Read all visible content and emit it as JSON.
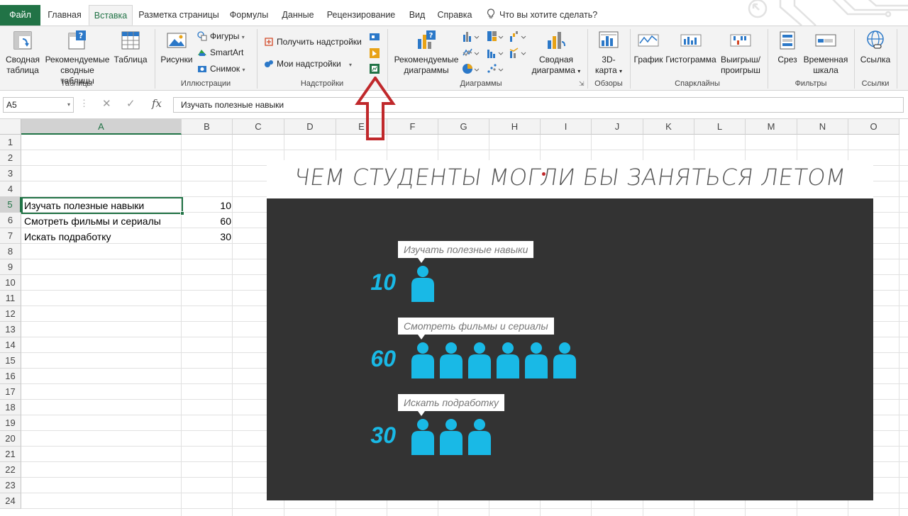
{
  "tabs": [
    "Файл",
    "Главная",
    "Вставка",
    "Разметка страницы",
    "Формулы",
    "Данные",
    "Рецензирование",
    "Вид",
    "Справка"
  ],
  "tell_me": "Что вы хотите сделать?",
  "ribbon": {
    "tables": {
      "label": "Таблицы",
      "pivot_line1": "Сводная",
      "pivot_line2": "таблица",
      "rec_pivot_line1": "Рекомендуемые",
      "rec_pivot_line2": "сводные таблицы",
      "table": "Таблица"
    },
    "illustrations": {
      "label": "Иллюстрации",
      "pictures": "Рисунки",
      "shapes": "Фигуры",
      "smartart": "SmartArt",
      "screenshot": "Снимок"
    },
    "addins": {
      "label": "Надстройки",
      "get": "Получить надстройки",
      "my": "Мои надстройки"
    },
    "charts": {
      "label": "Диаграммы",
      "rec_line1": "Рекомендуемые",
      "rec_line2": "диаграммы",
      "pivot_chart_line1": "Сводная",
      "pivot_chart_line2": "диаграмма"
    },
    "tours": {
      "label": "Обзоры",
      "map3d_line1": "3D-",
      "map3d_line2": "карта"
    },
    "sparklines": {
      "label": "Спарклайны",
      "line": "График",
      "column": "Гистограмма",
      "winloss_line1": "Выигрыш/",
      "winloss_line2": "проигрыш"
    },
    "filters": {
      "label": "Фильтры",
      "slicer": "Срез",
      "timeline_line1": "Временная",
      "timeline_line2": "шкала"
    },
    "links": {
      "label": "Ссылки",
      "link": "Ссылка"
    }
  },
  "formula_bar": {
    "name_box": "A5",
    "content": "Изучать полезные навыки"
  },
  "columns": [
    "A",
    "B",
    "C",
    "D",
    "E",
    "F",
    "G",
    "H",
    "I",
    "J",
    "K",
    "L",
    "M",
    "N",
    "O"
  ],
  "rows": [
    "1",
    "2",
    "3",
    "4",
    "5",
    "6",
    "7",
    "8",
    "9",
    "10",
    "11",
    "12",
    "13",
    "14",
    "15",
    "16",
    "17",
    "18",
    "19",
    "20",
    "21",
    "22",
    "23",
    "24"
  ],
  "cells": [
    {
      "label": "Изучать полезные навыки",
      "value": "10"
    },
    {
      "label": "Смотреть фильмы и сериалы",
      "value": "60"
    },
    {
      "label": "Искать подработку",
      "value": "30"
    }
  ],
  "chart_data": {
    "type": "table",
    "title": "ЧЕМ СТУДЕНТЫ МОГЛИ БЫ ЗАНЯТЬСЯ ЛЕТОМ",
    "categories": [
      "Изучать полезные навыки",
      "Смотреть фильмы и сериалы",
      "Искать подработку"
    ],
    "values": [
      10,
      60,
      30
    ],
    "icons_per_row": [
      1,
      6,
      3
    ],
    "background": "#333333",
    "accent": "#19b9e6"
  },
  "colors": {
    "excel_green": "#217346",
    "arrow_red": "#c0282b"
  }
}
